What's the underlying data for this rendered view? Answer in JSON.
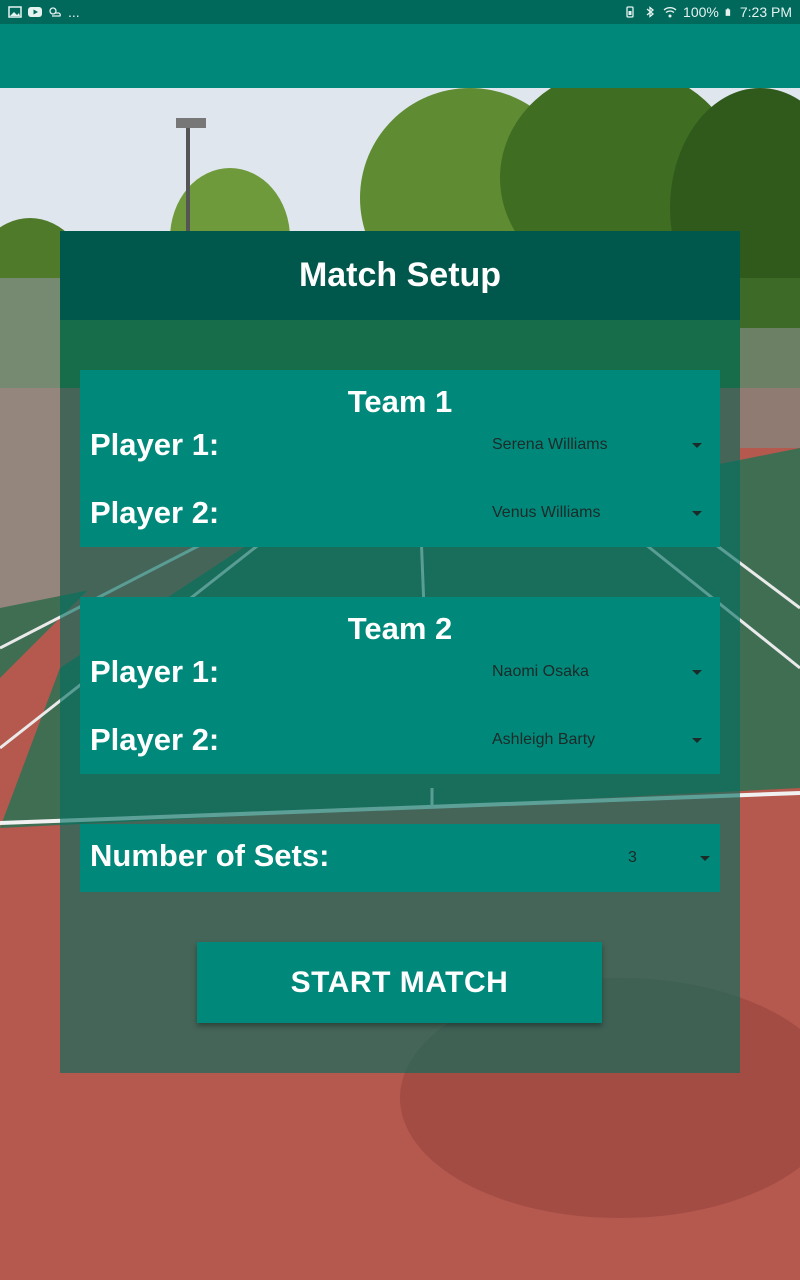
{
  "status_bar": {
    "left_icons": [
      "gallery-icon",
      "youtube-icon",
      "weather-icon"
    ],
    "overflow": "...",
    "battery": "100%",
    "time": "7:23 PM",
    "right_icons": [
      "battery-saver-icon",
      "bluetooth-icon",
      "wifi-icon",
      "battery-icon"
    ]
  },
  "colors": {
    "status_bar": "#00695c",
    "app_bar": "#00897b",
    "header": "#00574b",
    "card": "#00897b"
  },
  "page": {
    "title": "Match Setup"
  },
  "team1": {
    "title": "Team 1",
    "player1_label": "Player 1:",
    "player1_value": "Serena Williams",
    "player2_label": "Player 2:",
    "player2_value": "Venus Williams"
  },
  "team2": {
    "title": "Team 2",
    "player1_label": "Player 1:",
    "player1_value": "Naomi Osaka",
    "player2_label": "Player 2:",
    "player2_value": "Ashleigh Barty"
  },
  "sets": {
    "label": "Number of Sets:",
    "value": "3"
  },
  "actions": {
    "start_label": "START MATCH"
  }
}
